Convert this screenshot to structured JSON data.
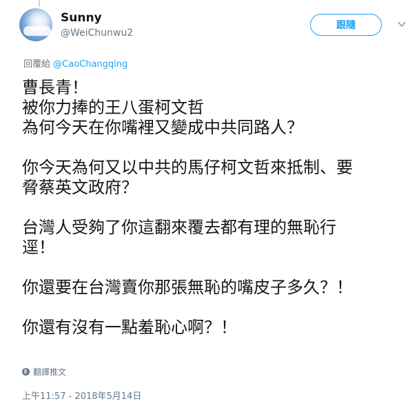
{
  "tweet": {
    "author": {
      "name": "Sunny",
      "handle": "@WeiChunwu2",
      "avatar_icon": "avatar-image"
    },
    "follow_label": "跟隨",
    "reply_prefix": "回覆給",
    "reply_mention": "@CaoChangqing",
    "paragraphs": [
      [
        "曹長青！",
        "被你力捧的王八蛋柯文哲",
        "為何今天在你嘴裡又變成中共同路人？"
      ],
      [
        "你今天為何又以中共的馬仔柯文哲來抵制、要",
        "脅蔡英文政府？"
      ],
      [
        "台灣人受夠了你這翻來覆去都有理的無恥行",
        "逕！"
      ],
      [
        "你還要在台灣賣你那張無恥的嘴皮子多久？！"
      ],
      [
        "你還有沒有一點羞恥心啊？！"
      ]
    ],
    "translate_label": "翻譯推文",
    "timestamp": "上午11:57 - 2018年5月14日"
  },
  "colors": {
    "accent": "#1da1f2",
    "secondary_text": "#657786",
    "primary_text": "#14171a"
  }
}
